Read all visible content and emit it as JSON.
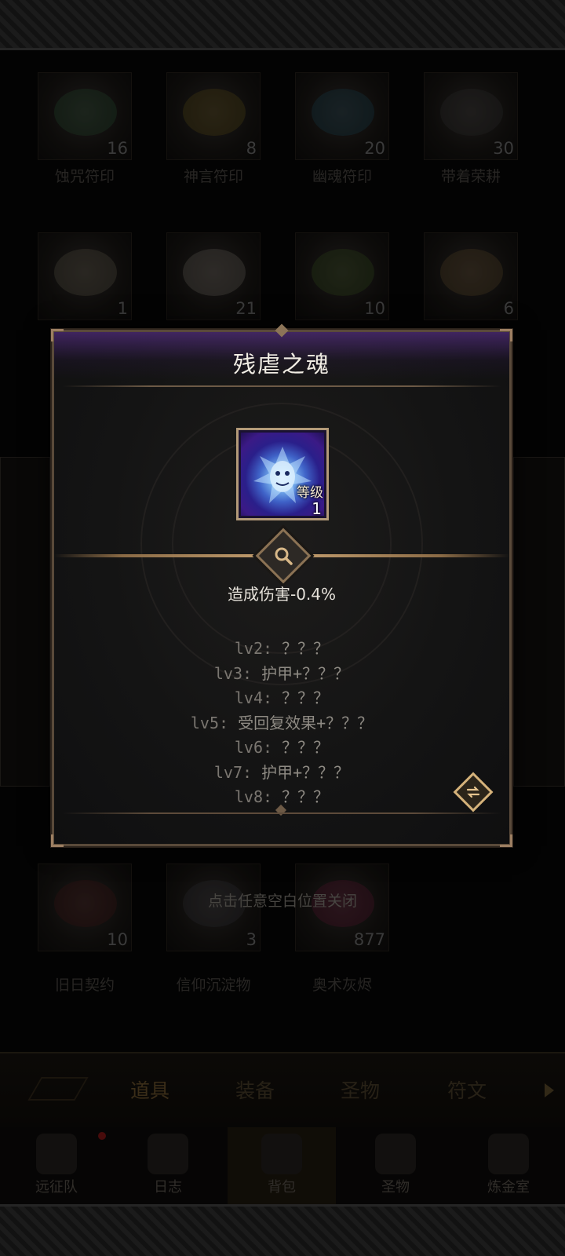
{
  "background": {
    "inventory_row1": [
      {
        "name": "蚀咒符印",
        "count": "16"
      },
      {
        "name": "神言符印",
        "count": "8"
      },
      {
        "name": "幽魂符印",
        "count": "20"
      },
      {
        "name": "带着荣耕",
        "count": "30"
      }
    ],
    "inventory_row2": [
      {
        "count": "1"
      },
      {
        "count": "21"
      },
      {
        "count": "10"
      },
      {
        "count": "6"
      }
    ],
    "inventory_row3": [
      {
        "name": "旧日契约",
        "count": "10"
      },
      {
        "name": "信仰沉淀物",
        "count": "3"
      },
      {
        "name": "奥术灰烬",
        "count": "877"
      }
    ],
    "close_hint": "点击任意空白位置关闭",
    "tabs": [
      "道具",
      "装备",
      "圣物",
      "符文"
    ],
    "active_tab": "道具",
    "nav": [
      {
        "label": "远征队"
      },
      {
        "label": "日志"
      },
      {
        "label": "背包"
      },
      {
        "label": "圣物"
      },
      {
        "label": "炼金室"
      }
    ]
  },
  "dialog": {
    "title": "残虐之魂",
    "item": {
      "level_label": "等级",
      "level_value": "1"
    },
    "effect": "造成伤害-0.4%",
    "levels": [
      {
        "key": "lv2:",
        "value": "？？？"
      },
      {
        "key": "lv3:",
        "value": "护甲+？？？"
      },
      {
        "key": "lv4:",
        "value": "？？？"
      },
      {
        "key": "lv5:",
        "value": "受回复效果+？？？"
      },
      {
        "key": "lv6:",
        "value": "？？？"
      },
      {
        "key": "lv7:",
        "value": "护甲+？？？"
      },
      {
        "key": "lv8:",
        "value": "？？？"
      }
    ]
  },
  "colors": {
    "dialog_border": "#5a4a3a",
    "title_glow": "#7a3cc8",
    "accent_gold": "#d5b27a"
  }
}
